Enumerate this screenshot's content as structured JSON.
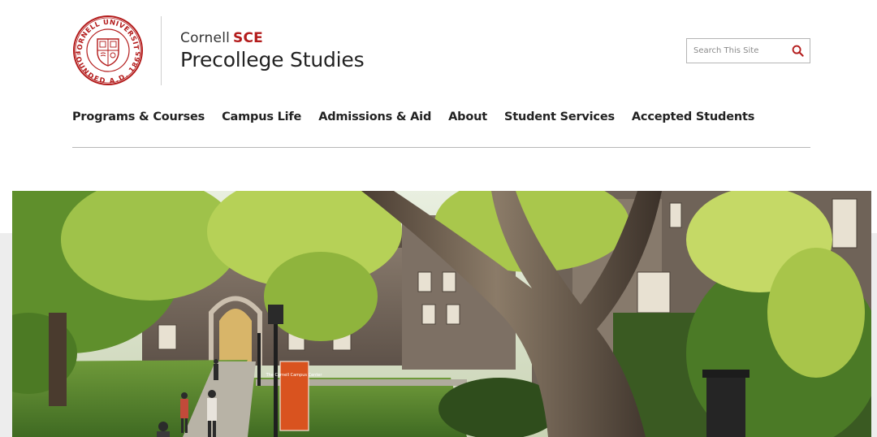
{
  "brand": {
    "line1_prefix": "Cornell",
    "line1_accent": "SCE",
    "title": "Precollege Studies",
    "seal_ring_top": "CORNELL UNIVERSITY",
    "seal_ring_bottom": "FOUNDED A.D. 1865",
    "accent_color": "#b31b1b"
  },
  "search": {
    "placeholder": "Search This Site",
    "icon": "search-icon"
  },
  "nav": {
    "items": [
      {
        "label": "Programs & Courses"
      },
      {
        "label": "Campus Life"
      },
      {
        "label": "Admissions & Aid"
      },
      {
        "label": "About"
      },
      {
        "label": "Student Services"
      },
      {
        "label": "Accepted Students"
      }
    ]
  },
  "hero": {
    "banner_text": "The Cornell Campus Center"
  }
}
